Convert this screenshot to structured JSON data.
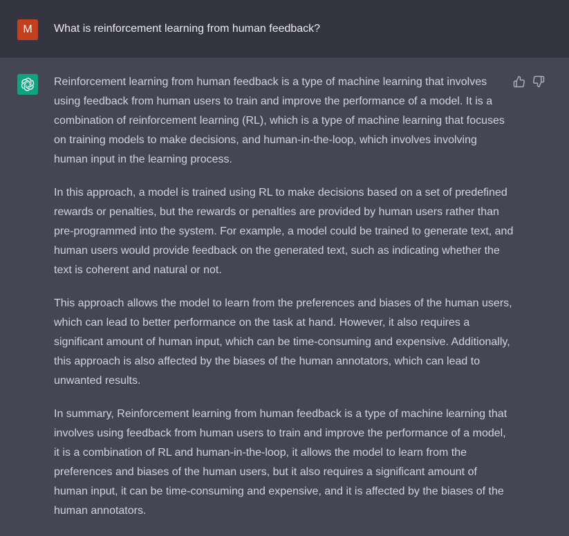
{
  "user_message": {
    "avatar_letter": "M",
    "avatar_color": "#c3401e",
    "text": "What is reinforcement learning from human feedback?"
  },
  "assistant_message": {
    "avatar_icon": "openai-logo-icon",
    "avatar_color": "#10a37f",
    "paragraphs": [
      "Reinforcement learning from human feedback is a type of machine learning that involves using feedback from human users to train and improve the performance of a model. It is a combination of reinforcement learning (RL), which is a type of machine learning that focuses on training models to make decisions, and human-in-the-loop, which involves involving human input in the learning process.",
      "In this approach, a model is trained using RL to make decisions based on a set of predefined rewards or penalties, but the rewards or penalties are provided by human users rather than pre-programmed into the system. For example, a model could be trained to generate text, and human users would provide feedback on the generated text, such as indicating whether the text is coherent and natural or not.",
      "This approach allows the model to learn from the preferences and biases of the human users, which can lead to better performance on the task at hand. However, it also requires a significant amount of human input, which can be time-consuming and expensive. Additionally, this approach is also affected by the biases of the human annotators, which can lead to unwanted results.",
      "In summary, Reinforcement learning from human feedback is a type of machine learning that involves using feedback from human users to train and improve the performance of a model, it is a combination of RL and human-in-the-loop, it allows the model to learn from the preferences and biases of the human users, but it also requires a significant amount of human input, it can be time-consuming and expensive, and it is affected by the biases of the human annotators."
    ],
    "feedback_icons": [
      "thumbs-up-icon",
      "thumbs-down-icon"
    ]
  },
  "colors": {
    "user_bg": "#343541",
    "assistant_bg": "#444654",
    "text": "#d1d5db"
  }
}
